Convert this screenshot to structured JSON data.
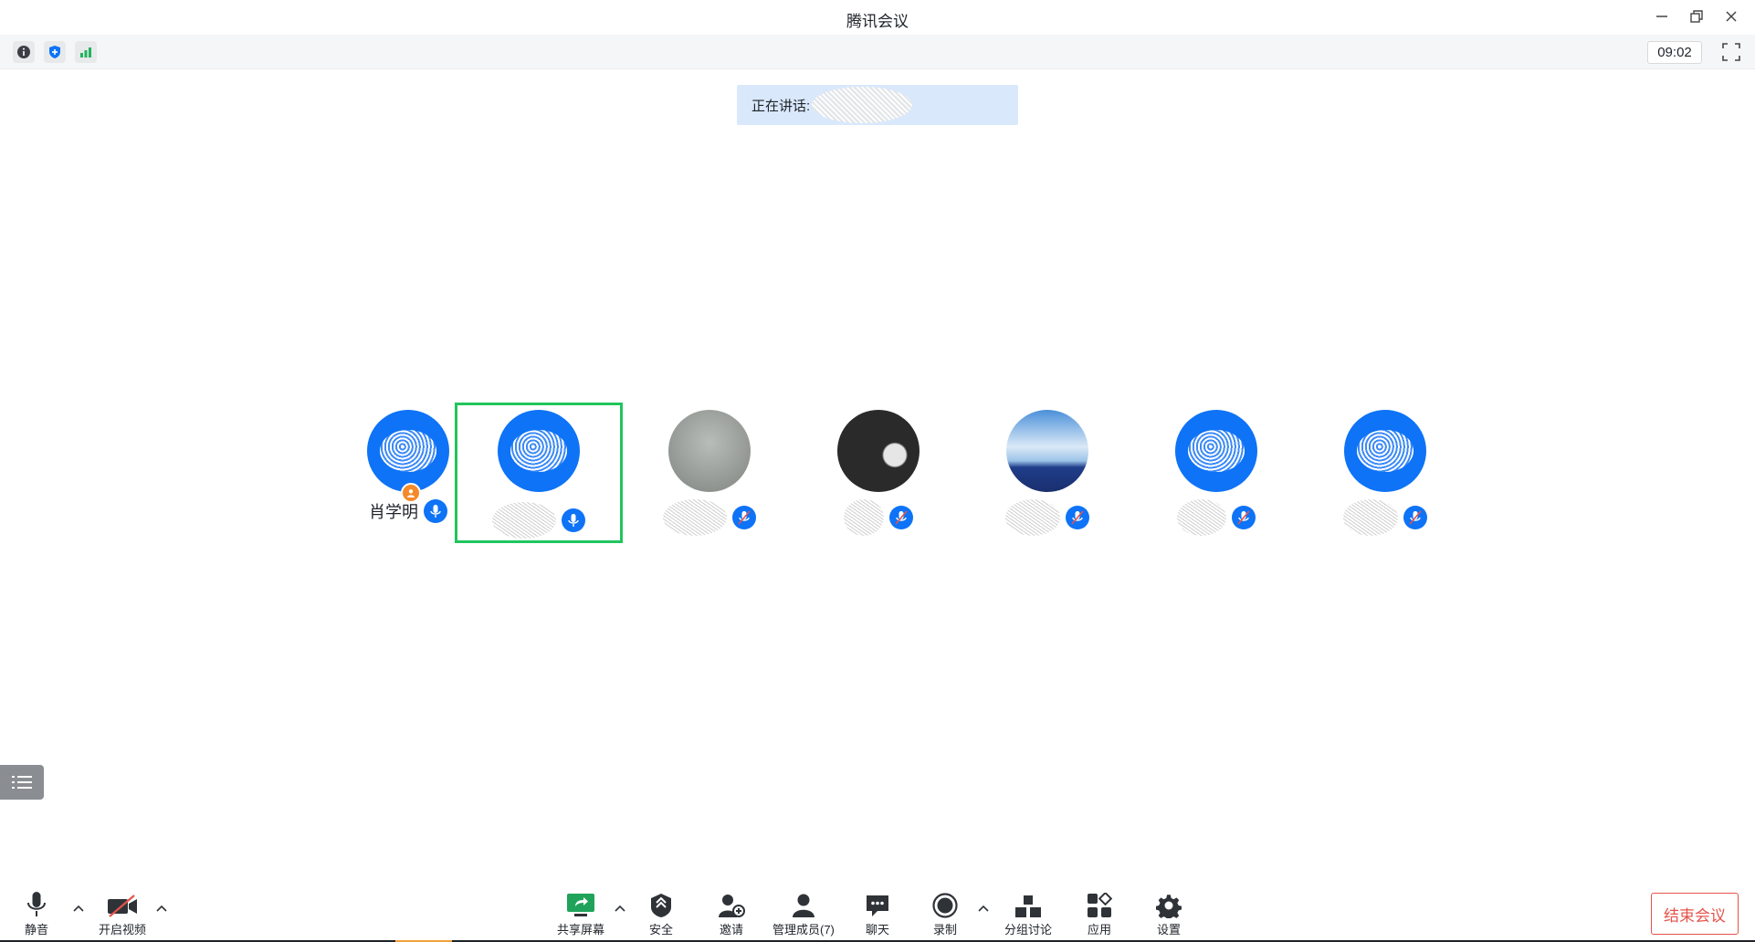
{
  "window": {
    "title": "腾讯会议"
  },
  "status": {
    "timer": "09:02"
  },
  "speaking": {
    "label": "正在讲话:"
  },
  "participants": [
    {
      "name": "肖学明",
      "host": true,
      "active": false,
      "avatar": "blue-scribble",
      "mic": "on"
    },
    {
      "name": "",
      "host": false,
      "active": true,
      "avatar": "blue-scribble",
      "mic": "on"
    },
    {
      "name": "",
      "host": false,
      "active": false,
      "avatar": "photo-gray",
      "mic": "muted"
    },
    {
      "name": "",
      "host": false,
      "active": false,
      "avatar": "photo-dark",
      "mic": "muted"
    },
    {
      "name": "",
      "host": false,
      "active": false,
      "avatar": "photo-sky",
      "mic": "muted"
    },
    {
      "name": "",
      "host": false,
      "active": false,
      "avatar": "blue-scribble",
      "mic": "muted"
    },
    {
      "name": "",
      "host": false,
      "active": false,
      "avatar": "blue-scribble",
      "mic": "muted"
    }
  ],
  "toolbar": {
    "mute": "静音",
    "video": "开启视频",
    "share": "共享屏幕",
    "security": "安全",
    "invite": "邀请",
    "members": "管理成员(7)",
    "chat": "聊天",
    "record": "录制",
    "breakout": "分组讨论",
    "apps": "应用",
    "settings": "设置",
    "end": "结束会议"
  },
  "colors": {
    "accent": "#0e73f6",
    "active_border": "#21c55d",
    "end": "#e5534b",
    "speaking_bg": "#d9e8fb"
  }
}
